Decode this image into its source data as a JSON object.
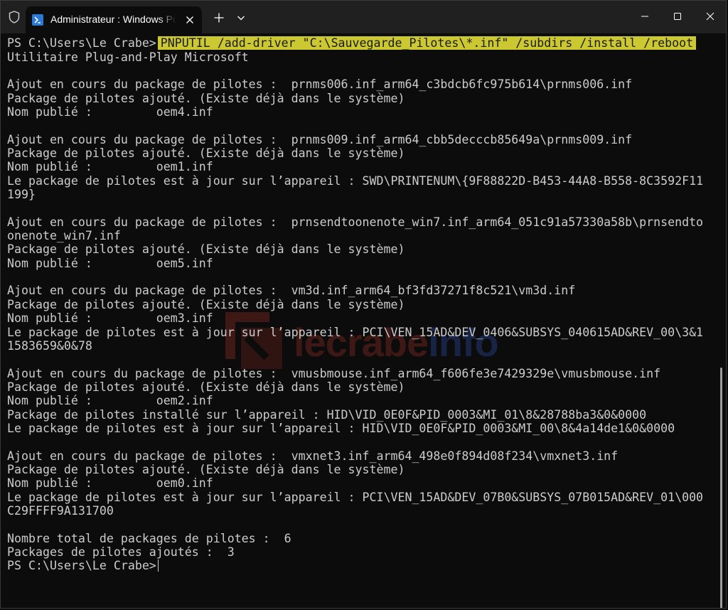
{
  "window": {
    "tab_title": "Administrateur : Windows PowerShell",
    "icons": {
      "shield": "shield-icon",
      "tab": "powershell-icon",
      "close_tab": "close-icon",
      "new_tab": "plus-icon",
      "dropdown": "chevron-down-icon",
      "minimize": "minimize-icon",
      "maximize": "maximize-icon",
      "close": "close-icon"
    }
  },
  "watermark": {
    "part1": "lecrabe",
    "part2": "info"
  },
  "terminal": {
    "prompt": "PS C:\\Users\\Le Crabe>",
    "command": "PNPUTIL /add-driver \"C:\\Sauvegarde_Pilotes\\*.inf\" /subdirs /install /reboot",
    "lines": [
      "Utilitaire Plug-and-Play Microsoft",
      "",
      "Ajout en cours du package de pilotes :  prnms006.inf_arm64_c3bdcb6fc975b614\\prnms006.inf",
      "Package de pilotes ajouté. (Existe déjà dans le système)",
      "Nom publié :         oem4.inf",
      "",
      "Ajout en cours du package de pilotes :  prnms009.inf_arm64_cbb5decccb85649a\\prnms009.inf",
      "Package de pilotes ajouté. (Existe déjà dans le système)",
      "Nom publié :         oem1.inf",
      "Le package de pilotes est à jour sur l’appareil : SWD\\PRINTENUM\\{9F88822D-B453-44A8-B558-8C3592F11",
      "199}",
      "",
      "Ajout en cours du package de pilotes :  prnsendtoonenote_win7.inf_arm64_051c91a57330a58b\\prnsendto",
      "onenote_win7.inf",
      "Package de pilotes ajouté. (Existe déjà dans le système)",
      "Nom publié :         oem5.inf",
      "",
      "Ajout en cours du package de pilotes :  vm3d.inf_arm64_bf3fd37271f8c521\\vm3d.inf",
      "Package de pilotes ajouté. (Existe déjà dans le système)",
      "Nom publié :         oem3.inf",
      "Le package de pilotes est à jour sur l’appareil : PCI\\VEN_15AD&DEV_0406&SUBSYS_040615AD&REV_00\\3&1",
      "1583659&0&78",
      "",
      "Ajout en cours du package de pilotes :  vmusbmouse.inf_arm64_f606fe3e7429329e\\vmusbmouse.inf",
      "Package de pilotes ajouté. (Existe déjà dans le système)",
      "Nom publié :         oem2.inf",
      "Package de pilotes installé sur l’appareil : HID\\VID_0E0F&PID_0003&MI_01\\8&28788ba3&0&0000",
      "Le package de pilotes est à jour sur l’appareil : HID\\VID_0E0F&PID_0003&MI_00\\8&4a14de1&0&0000",
      "",
      "Ajout en cours du package de pilotes :  vmxnet3.inf_arm64_498e0f894d08f234\\vmxnet3.inf",
      "Package de pilotes ajouté. (Existe déjà dans le système)",
      "Nom publié :         oem0.inf",
      "Le package de pilotes est à jour sur l’appareil : PCI\\VEN_15AD&DEV_07B0&SUBSYS_07B015AD&REV_01\\000",
      "C29FFFF9A131700",
      "",
      "Nombre total de packages de pilotes :  6",
      "Packages de pilotes ajoutés :  3"
    ],
    "final_prompt": "PS C:\\Users\\Le Crabe>"
  },
  "colors": {
    "background": "#0c0c0c",
    "titlebar": "#202020",
    "text": "#cccccc",
    "highlight": "#ccc832",
    "accent": "#2b78d6"
  }
}
